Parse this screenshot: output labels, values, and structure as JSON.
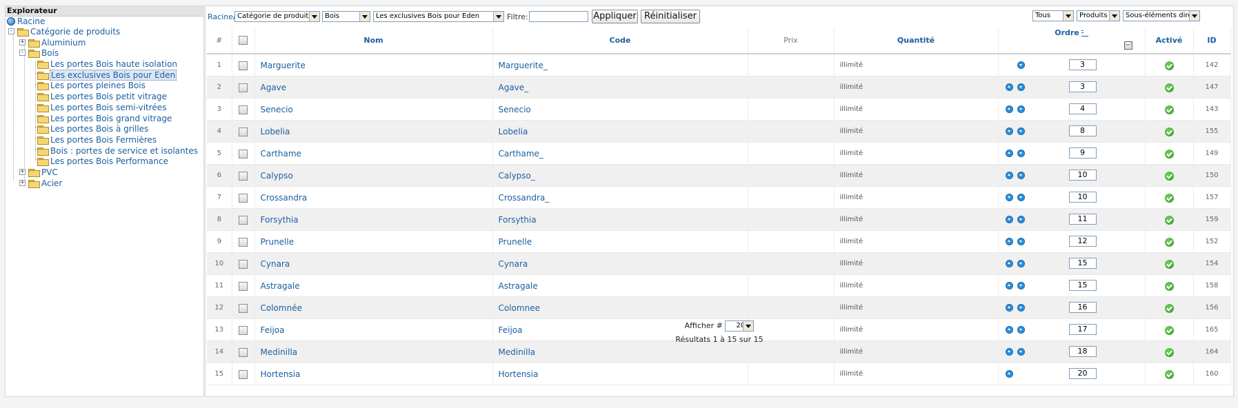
{
  "explorer": {
    "title": "Explorateur",
    "nodes": [
      {
        "label": "Racine"
      },
      {
        "label": "Catégorie de produits"
      },
      {
        "label": "Aluminium"
      },
      {
        "label": "Bois"
      },
      {
        "label": "Les portes Bois haute isolation"
      },
      {
        "label": "Les exclusives Bois pour Eden"
      },
      {
        "label": "Les portes pleines Bois"
      },
      {
        "label": "Les portes Bois petit vitrage"
      },
      {
        "label": "Les portes Bois semi-vitrées"
      },
      {
        "label": "Les portes Bois grand vitrage"
      },
      {
        "label": "Les portes Bois à grilles"
      },
      {
        "label": "Les portes Bois Fermières"
      },
      {
        "label": "Bois : portes de service et isolantes"
      },
      {
        "label": "Les portes Bois Performance"
      },
      {
        "label": "PVC"
      },
      {
        "label": "Acier"
      }
    ]
  },
  "toolbar": {
    "breadcrumb": "Racine/",
    "select1": "Catégorie de produits",
    "select2": "Bois",
    "select3": "Les exclusives Bois pour Eden",
    "filter_label": "Filtre:",
    "filter_value": "",
    "apply_label": "Appliquer",
    "reset_label": "Réinitialiser",
    "right_select1": "Tous",
    "right_select2": "Produits",
    "right_select3": "Sous-éléments directs"
  },
  "table": {
    "headers": {
      "num": "#",
      "nom": "Nom",
      "code": "Code",
      "prix": "Prix",
      "quantite": "Quantité",
      "ordre": "Ordre",
      "active": "Activé",
      "id": "ID"
    },
    "rows": [
      {
        "num": "1",
        "nom": "Marguerite",
        "code": "Marguerite_",
        "prix": "",
        "qty": "illimité",
        "order": "3",
        "id": "142"
      },
      {
        "num": "2",
        "nom": "Agave",
        "code": "Agave_",
        "prix": "",
        "qty": "illimité",
        "order": "3",
        "id": "147"
      },
      {
        "num": "3",
        "nom": "Senecio",
        "code": "Senecio",
        "prix": "",
        "qty": "illimité",
        "order": "4",
        "id": "143"
      },
      {
        "num": "4",
        "nom": "Lobelia",
        "code": "Lobelia",
        "prix": "",
        "qty": "illimité",
        "order": "8",
        "id": "155"
      },
      {
        "num": "5",
        "nom": "Carthame",
        "code": "Carthame_",
        "prix": "",
        "qty": "illimité",
        "order": "9",
        "id": "149"
      },
      {
        "num": "6",
        "nom": "Calypso",
        "code": "Calypso_",
        "prix": "",
        "qty": "illimité",
        "order": "10",
        "id": "150"
      },
      {
        "num": "7",
        "nom": "Crossandra",
        "code": "Crossandra_",
        "prix": "",
        "qty": "illimité",
        "order": "10",
        "id": "157"
      },
      {
        "num": "8",
        "nom": "Forsythia",
        "code": "Forsythia",
        "prix": "",
        "qty": "illimité",
        "order": "11",
        "id": "159"
      },
      {
        "num": "9",
        "nom": "Prunelle",
        "code": "Prunelle",
        "prix": "",
        "qty": "illimité",
        "order": "12",
        "id": "152"
      },
      {
        "num": "10",
        "nom": "Cynara",
        "code": "Cynara",
        "prix": "",
        "qty": "illimité",
        "order": "15",
        "id": "154"
      },
      {
        "num": "11",
        "nom": "Astragale",
        "code": "Astragale",
        "prix": "",
        "qty": "illimité",
        "order": "15",
        "id": "158"
      },
      {
        "num": "12",
        "nom": "Colomnée",
        "code": "Colomnee",
        "prix": "",
        "qty": "illimité",
        "order": "16",
        "id": "156"
      },
      {
        "num": "13",
        "nom": "Feijoa",
        "code": "Feijoa",
        "prix": "",
        "qty": "illimité",
        "order": "17",
        "id": "165"
      },
      {
        "num": "14",
        "nom": "Medinilla",
        "code": "Medinilla",
        "prix": "",
        "qty": "illimité",
        "order": "18",
        "id": "164"
      },
      {
        "num": "15",
        "nom": "Hortensia",
        "code": "Hortensia",
        "prix": "",
        "qty": "illimité",
        "order": "20",
        "id": "160"
      }
    ]
  },
  "footer": {
    "show_label": "Afficher #",
    "per_page": "20",
    "results": "Résultats 1 à 15 sur 15"
  },
  "colors": {
    "link": "#1b5fa0",
    "active_green": "#2e9a1e",
    "alt_row": "#f0f0f0"
  }
}
